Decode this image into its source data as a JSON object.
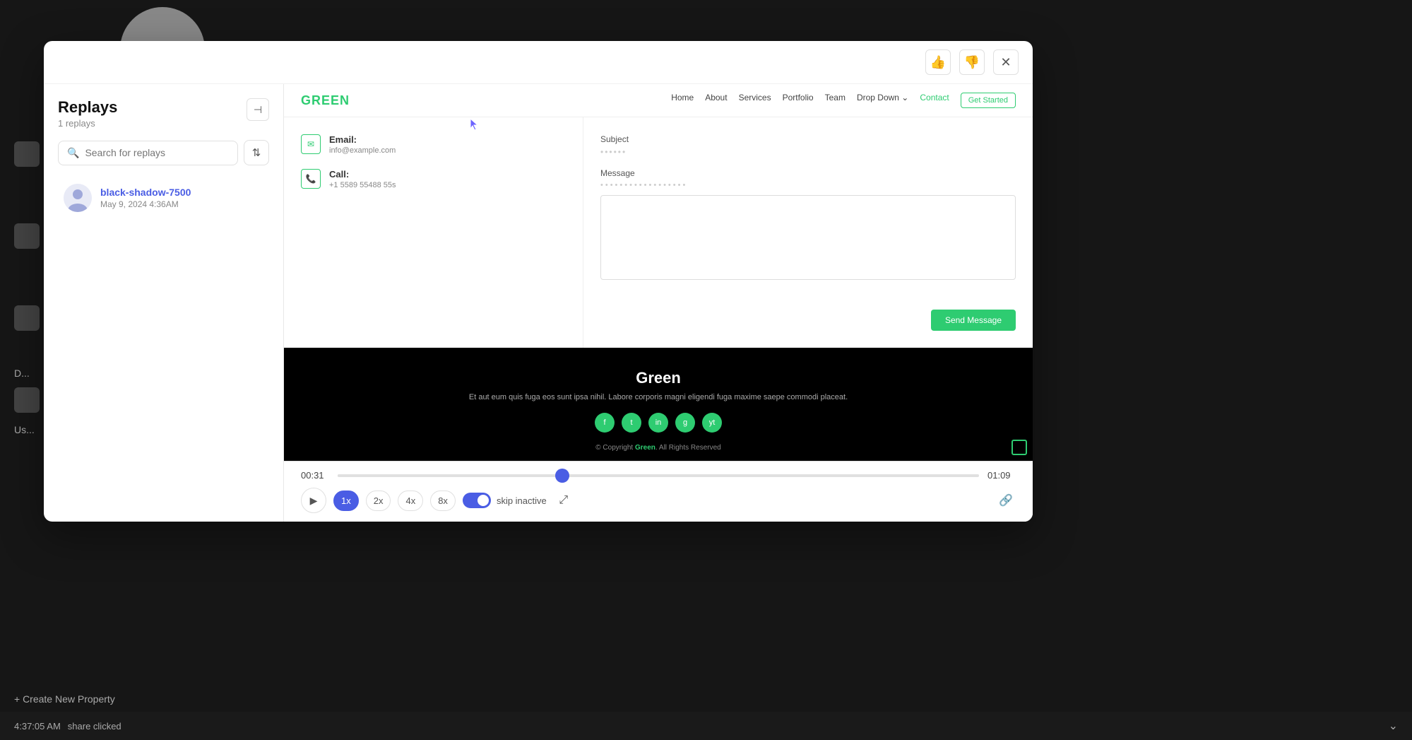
{
  "background": {
    "avatar_initial": "●"
  },
  "modal": {
    "thumbs_up_label": "👍",
    "thumbs_down_label": "👎",
    "close_label": "✕"
  },
  "sidebar": {
    "title": "Replays",
    "count": "1 replays",
    "collapse_icon": "⊣",
    "search_placeholder": "Search for replays",
    "filter_icon": "⇅",
    "replay_item": {
      "name": "black-shadow-7500",
      "date": "May 9, 2024 4:36AM"
    }
  },
  "site": {
    "logo": "GREEN",
    "nav_links": [
      "Home",
      "About",
      "Services",
      "Portfolio",
      "Team",
      "Drop Down ⌄",
      "Contact"
    ],
    "cta": "Get Started",
    "email_label": "Email:",
    "email_value": "info@example.com",
    "call_label": "Call:",
    "call_value": "+1 5589 55488 55s",
    "form_subject_label": "Subject",
    "form_subject_dots": "••••••",
    "form_message_label": "Message",
    "form_message_dots": "••••••••••••••••••",
    "send_btn": "Send Message"
  },
  "bottom_section": {
    "title": "Green",
    "description": "Et aut eum quis fuga eos sunt ipsa nihil. Labore corporis magni eligendi fuga maxime saepe commodi placeat.",
    "copyright": "© Copyright Green. All Rights Reserved"
  },
  "playback": {
    "time_current": "00:31",
    "time_total": "01:09",
    "play_icon": "▶",
    "speeds": [
      "1x",
      "2x",
      "4x",
      "8x"
    ],
    "active_speed": "1x",
    "skip_inactive_label": "skip inactive",
    "expand_icon": "⤢",
    "link_icon": "🔗"
  },
  "status_bar": {
    "time": "4:37:05 AM",
    "event": "share clicked",
    "arrow": "⌄"
  },
  "create_property": "+ Create New Property",
  "users_label": "Us...",
  "downloads_label": "D..."
}
